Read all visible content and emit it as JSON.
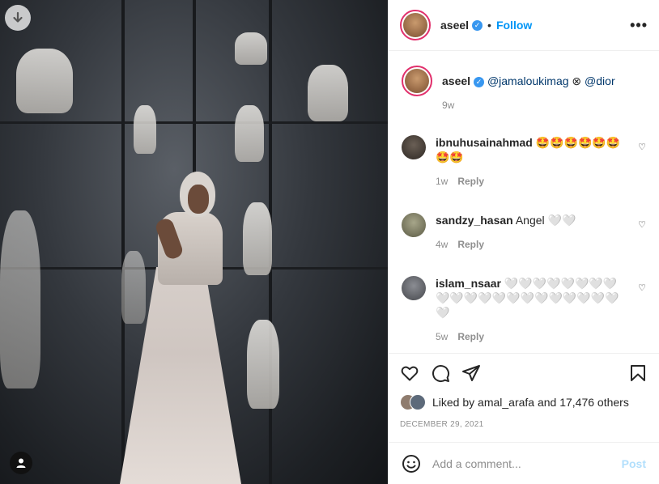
{
  "post": {
    "username": "aseel",
    "follow_label": "Follow",
    "more_label": "•••"
  },
  "caption": {
    "username": "aseel",
    "mention1": "@jamaloukimag",
    "mention2": "@dior",
    "time": "9w"
  },
  "comments": [
    {
      "username": "ibnuhusainahmad",
      "text": "🤩🤩🤩🤩🤩🤩🤩🤩",
      "time": "1w",
      "reply": "Reply"
    },
    {
      "username": "sandzy_hasan",
      "text": "Angel 🤍🤍",
      "time": "4w",
      "reply": "Reply"
    },
    {
      "username": "islam_nsaar",
      "text": "🤍🤍🤍🤍🤍🤍🤍🤍🤍🤍🤍🤍🤍🤍🤍🤍🤍🤍🤍🤍🤍🤍",
      "time": "5w",
      "reply": "Reply"
    }
  ],
  "likes": {
    "text": "Liked by amal_arafa and 17,476 others"
  },
  "date": "DECEMBER 29, 2021",
  "add_comment": {
    "placeholder": "Add a comment...",
    "post_label": "Post"
  },
  "icons": [
    "download-icon",
    "user-icon",
    "verified-icon",
    "more-icon",
    "heart-icon",
    "comment-icon",
    "share-icon",
    "save-icon",
    "emoji-icon"
  ]
}
